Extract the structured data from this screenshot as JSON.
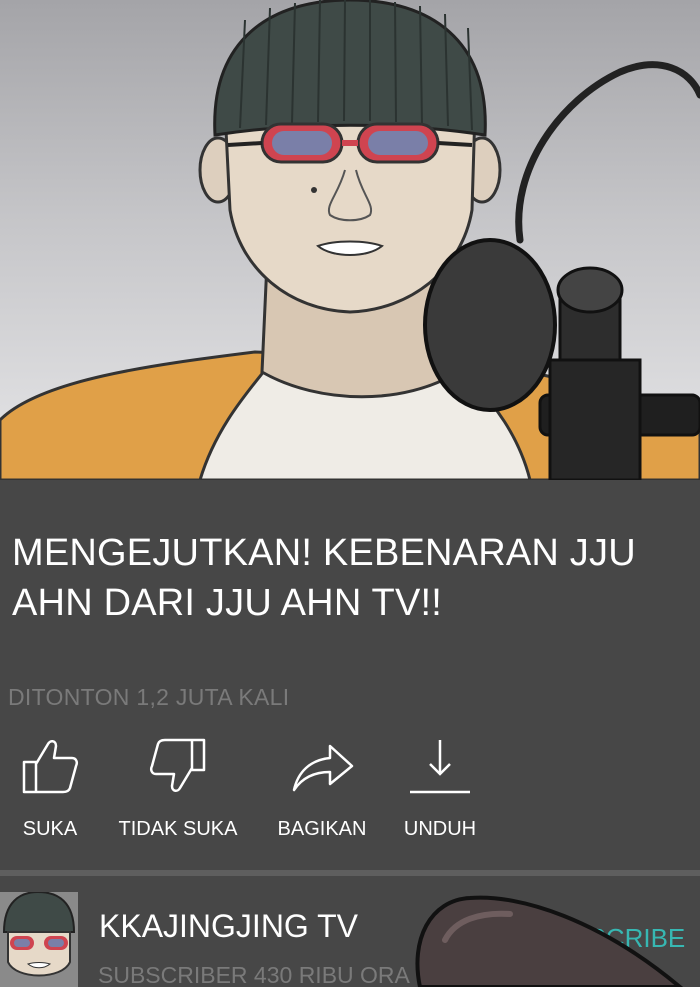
{
  "video": {
    "title": "MENGEJUTKAN! KEBENARAN JJU AHN DARI JJU AHN TV!!",
    "views": "DITONTON 1,2 JUTA KALI",
    "thumbnail_icon": "streamer-with-microphone-illustration"
  },
  "actions": [
    {
      "label": "SUKA",
      "icon": "thumbs-up-icon"
    },
    {
      "label": "TIDAK SUKA",
      "icon": "thumbs-down-icon"
    },
    {
      "label": "BAGIKAN",
      "icon": "share-arrow-icon"
    },
    {
      "label": "UNDUH",
      "icon": "download-icon"
    }
  ],
  "channel": {
    "name": "KKAJINGJING TV",
    "subscribers": "SUBSCRIBER 430 RIBU ORA",
    "subscribe_label": "SUBSCRIBE"
  },
  "colors": {
    "background": "#474747",
    "accent": "#37b7b2",
    "muted_text": "#7a7a7a",
    "sweater": "#e0a048"
  }
}
